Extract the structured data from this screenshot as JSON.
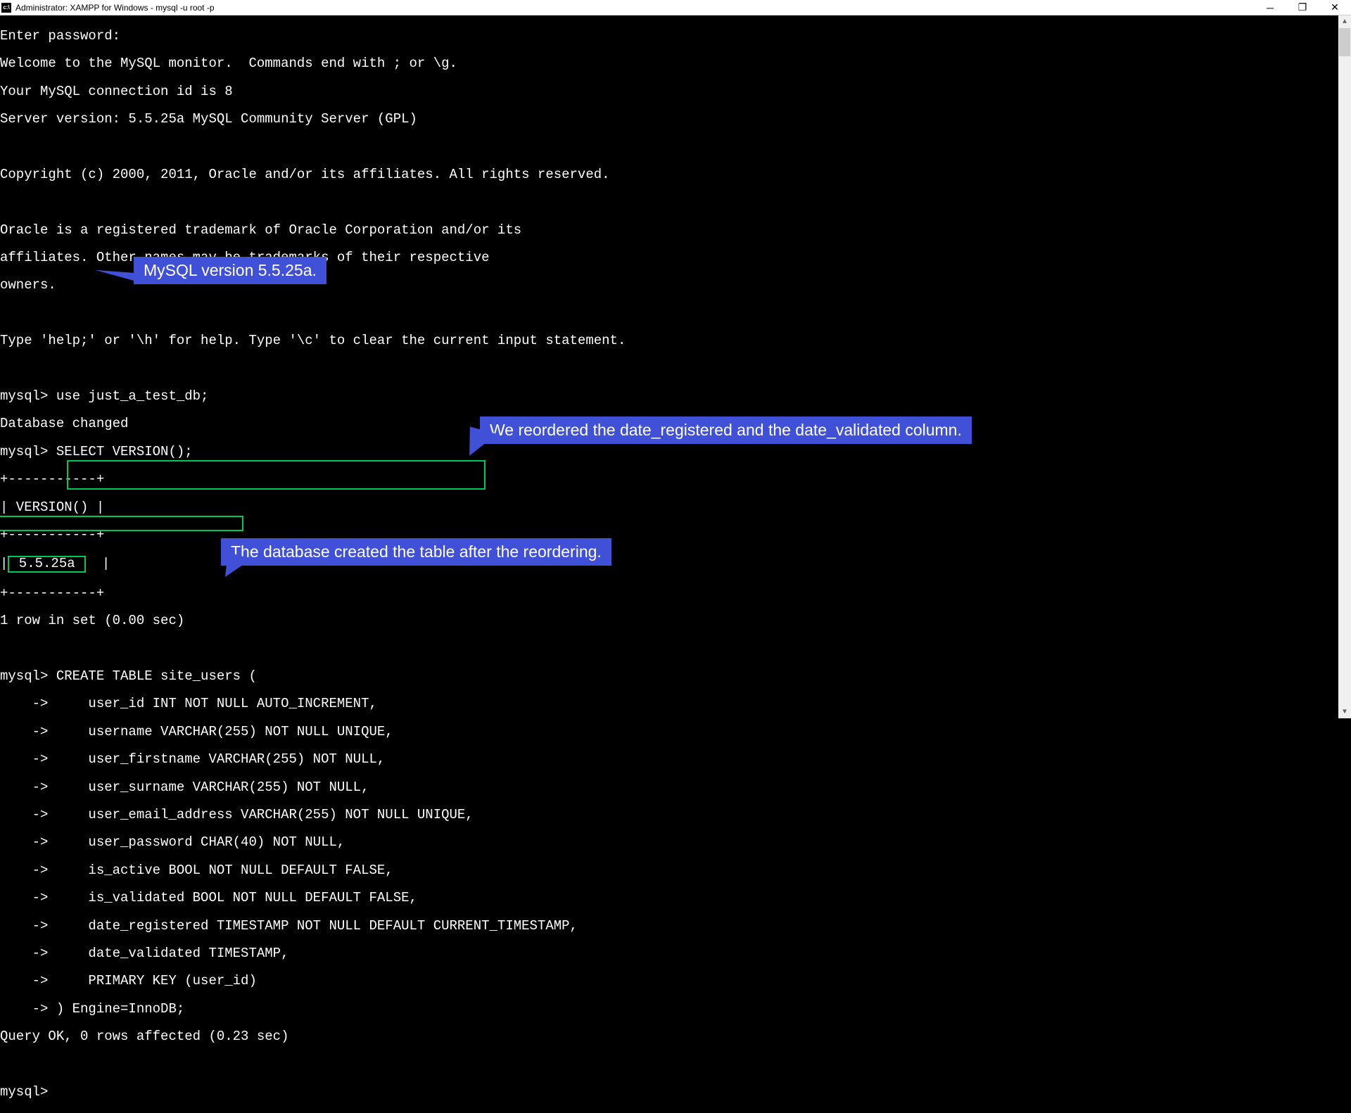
{
  "titlebar": {
    "title": "Administrator: XAMPP for Windows - mysql  -u root -p"
  },
  "terminal": {
    "lines": {
      "l01": "Enter password:",
      "l02": "Welcome to the MySQL monitor.  Commands end with ; or \\g.",
      "l03": "Your MySQL connection id is 8",
      "l04": "Server version: 5.5.25a MySQL Community Server (GPL)",
      "l05": "Copyright (c) 2000, 2011, Oracle and/or its affiliates. All rights reserved.",
      "l06": "Oracle is a registered trademark of Oracle Corporation and/or its",
      "l07": "affiliates. Other names may be trademarks of their respective",
      "l08": "owners.",
      "l09": "Type 'help;' or '\\h' for help. Type '\\c' to clear the current input statement.",
      "l10": "mysql> use just_a_test_db;",
      "l11": "Database changed",
      "l12": "mysql> SELECT VERSION();",
      "l13": "+-----------+",
      "l14": "| VERSION() |",
      "l15": "+-----------+",
      "l16a": "|",
      "l16b": " 5.5.25a ",
      "l16c": "  |",
      "l17": "+-----------+",
      "l18": "1 row in set (0.00 sec)",
      "l19": "mysql> CREATE TABLE site_users (",
      "l20": "    ->     user_id INT NOT NULL AUTO_INCREMENT,",
      "l21": "    ->     username VARCHAR(255) NOT NULL UNIQUE,",
      "l22": "    ->     user_firstname VARCHAR(255) NOT NULL,",
      "l23": "    ->     user_surname VARCHAR(255) NOT NULL,",
      "l24": "    ->     user_email_address VARCHAR(255) NOT NULL UNIQUE,",
      "l25": "    ->     user_password CHAR(40) NOT NULL,",
      "l26": "    ->     is_active BOOL NOT NULL DEFAULT FALSE,",
      "l27": "    ->     is_validated BOOL NOT NULL DEFAULT FALSE,",
      "l28": "    ->     date_registered TIMESTAMP NOT NULL DEFAULT CURRENT_TIMESTAMP,",
      "l29": "    ->     date_validated TIMESTAMP,",
      "l30": "    ->     PRIMARY KEY (user_id)",
      "l31": "    -> ) Engine=InnoDB;",
      "l32": "Query OK, 0 rows affected (0.23 sec)",
      "l33": "mysql>"
    }
  },
  "callouts": {
    "c1": "MySQL version 5.5.25a.",
    "c2": "We reordered the date_registered and the date_validated column.",
    "c3": "The database created the table after the reordering."
  }
}
